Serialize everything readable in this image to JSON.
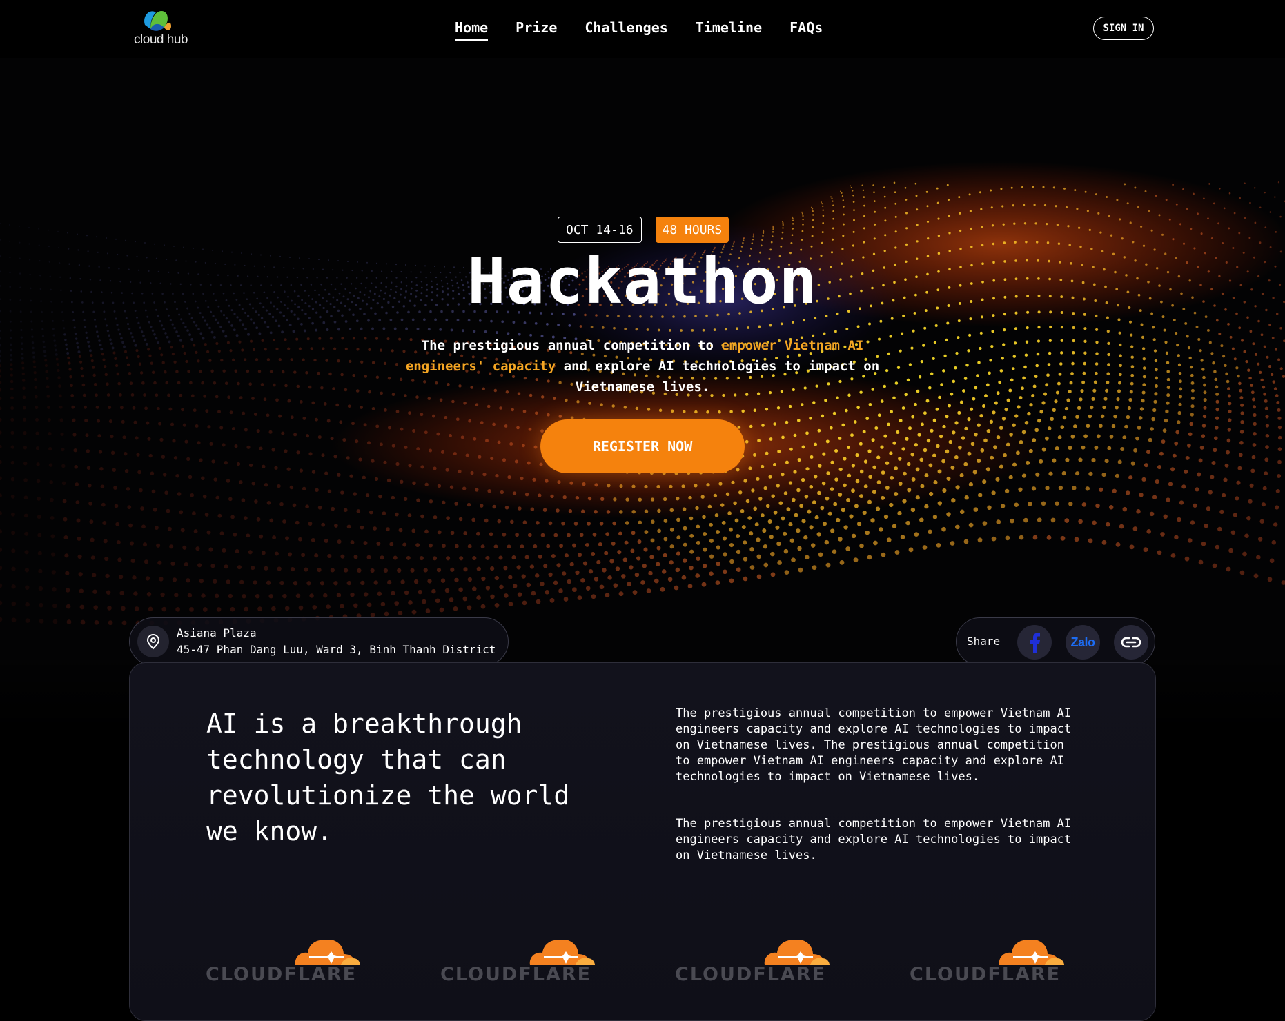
{
  "header": {
    "logo_text": "cloud hub",
    "nav": [
      {
        "label": "Home",
        "active": true
      },
      {
        "label": "Prize",
        "active": false
      },
      {
        "label": "Challenges",
        "active": false
      },
      {
        "label": "Timeline",
        "active": false
      },
      {
        "label": "FAQs",
        "active": false
      }
    ],
    "signin_label": "SIGN IN"
  },
  "hero": {
    "date_badge": "OCT 14-16",
    "duration_badge": "48 HOURS",
    "title": "Hackathon",
    "desc_part1": "The prestigious annual competition to ",
    "desc_highlight": "empower Vietnam AI engineers' capacity",
    "desc_part2": " and explore AI technologies to impact on Vietnamese lives.",
    "register_label": "REGISTER NOW",
    "accent_color": "#f5820d",
    "highlight_color": "#f5a623"
  },
  "location": {
    "name": "Asiana Plaza",
    "address": "45-47 Phan Dang Luu, Ward 3, Binh Thanh District",
    "icon": "location-pin-icon"
  },
  "share": {
    "label": "Share",
    "zalo_label": "Zalo",
    "icons": [
      "facebook-icon",
      "zalo-icon",
      "link-icon"
    ]
  },
  "about": {
    "heading": "AI is a breakthrough technology that can revolutionize the world we know.",
    "paragraph1": "The prestigious annual competition to empower Vietnam AI engineers capacity and explore AI technologies to impact on Vietnamese lives. The prestigious annual competition to empower Vietnam AI engineers capacity and explore AI technologies to impact on Vietnamese lives.",
    "paragraph2": "The prestigious annual competition to empower Vietnam AI engineers capacity and explore AI technologies to impact on Vietnamese lives.",
    "sponsors": [
      "CLOUDFLARE",
      "CLOUDFLARE",
      "CLOUDFLARE",
      "CLOUDFLARE"
    ]
  }
}
